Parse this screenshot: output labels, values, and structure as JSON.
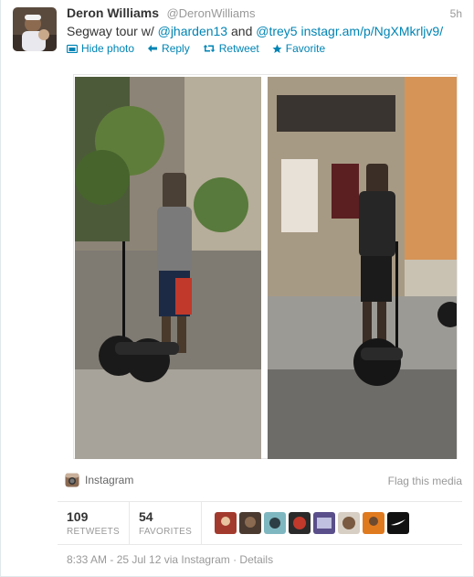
{
  "tweet": {
    "fullname": "Deron Williams",
    "username": "@DeronWilliams",
    "time": "5h",
    "text_parts": {
      "prefix": "Segway tour w/ ",
      "mention1": "@jharden13",
      "middle": " and ",
      "mention2": "@trey5",
      "space": " ",
      "url": "instagr.am/p/NgXMkrljv9/"
    }
  },
  "actions": {
    "hide_photo": "Hide photo",
    "reply": "Reply",
    "retweet": "Retweet",
    "favorite": "Favorite"
  },
  "media": {
    "source": "Instagram",
    "flag": "Flag this media"
  },
  "stats": {
    "retweets_count": "109",
    "retweets_label": "RETWEETS",
    "favorites_count": "54",
    "favorites_label": "FAVORITES"
  },
  "meta": {
    "timestamp": "8:33 AM - 25 Jul 12 via Instagram · Details"
  },
  "colors": {
    "link": "#0084b4",
    "muted": "#999999",
    "text": "#333333"
  }
}
